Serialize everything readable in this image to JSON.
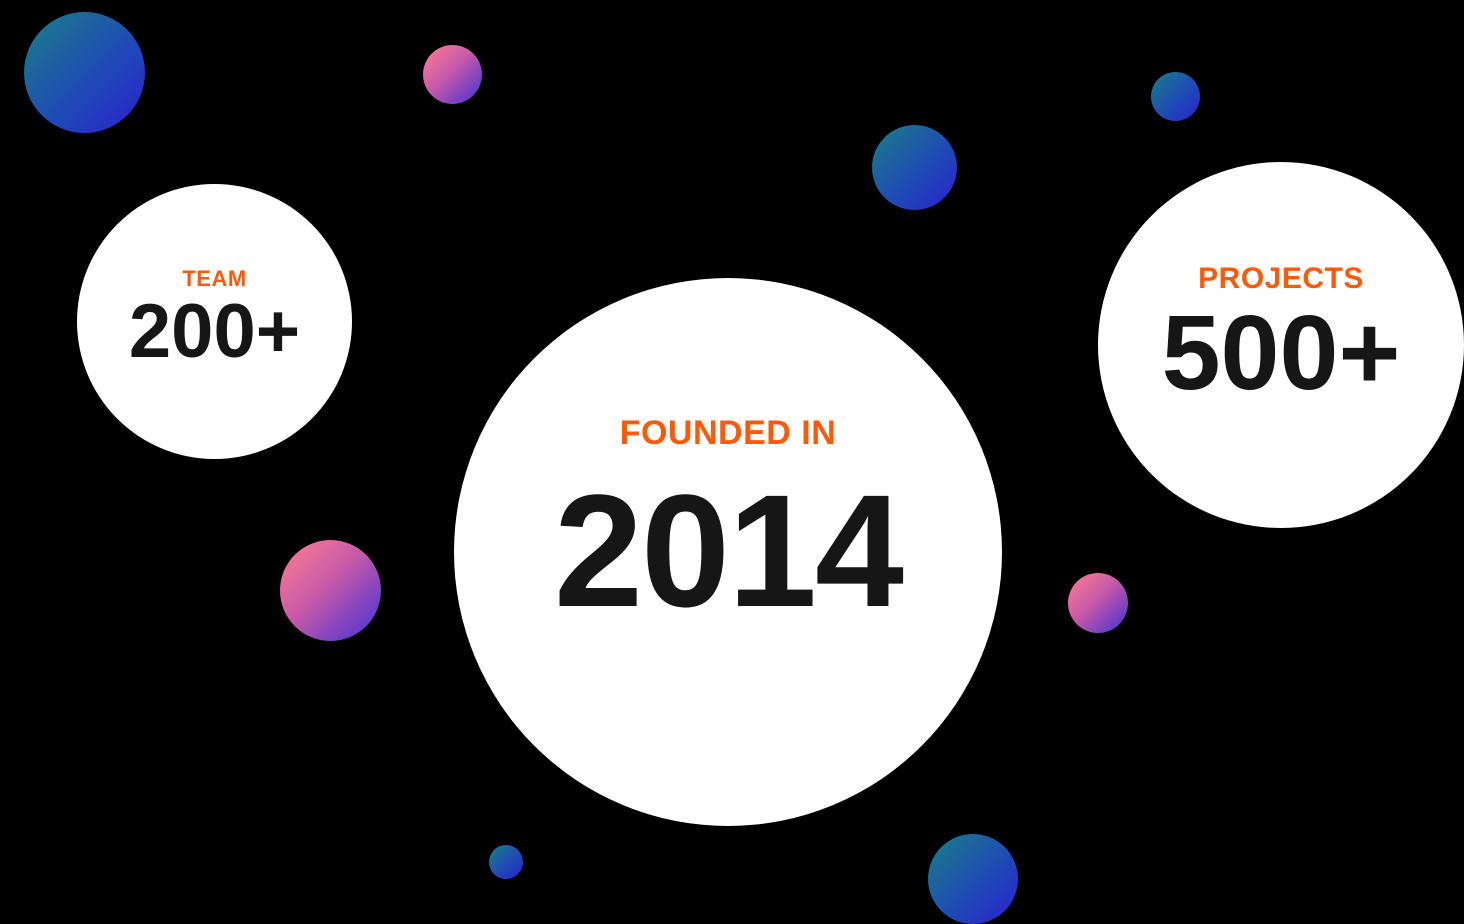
{
  "stats": {
    "team": {
      "label": "TEAM",
      "value": "200+"
    },
    "founded": {
      "label": "FOUNDED IN",
      "value": "2014"
    },
    "projects": {
      "label": "PROJECTS",
      "value": "500+"
    }
  },
  "colors": {
    "background": "#000000",
    "label_accent": "#ff5a0a",
    "value_text": "#161616",
    "circle_fill": "#ffffff"
  }
}
